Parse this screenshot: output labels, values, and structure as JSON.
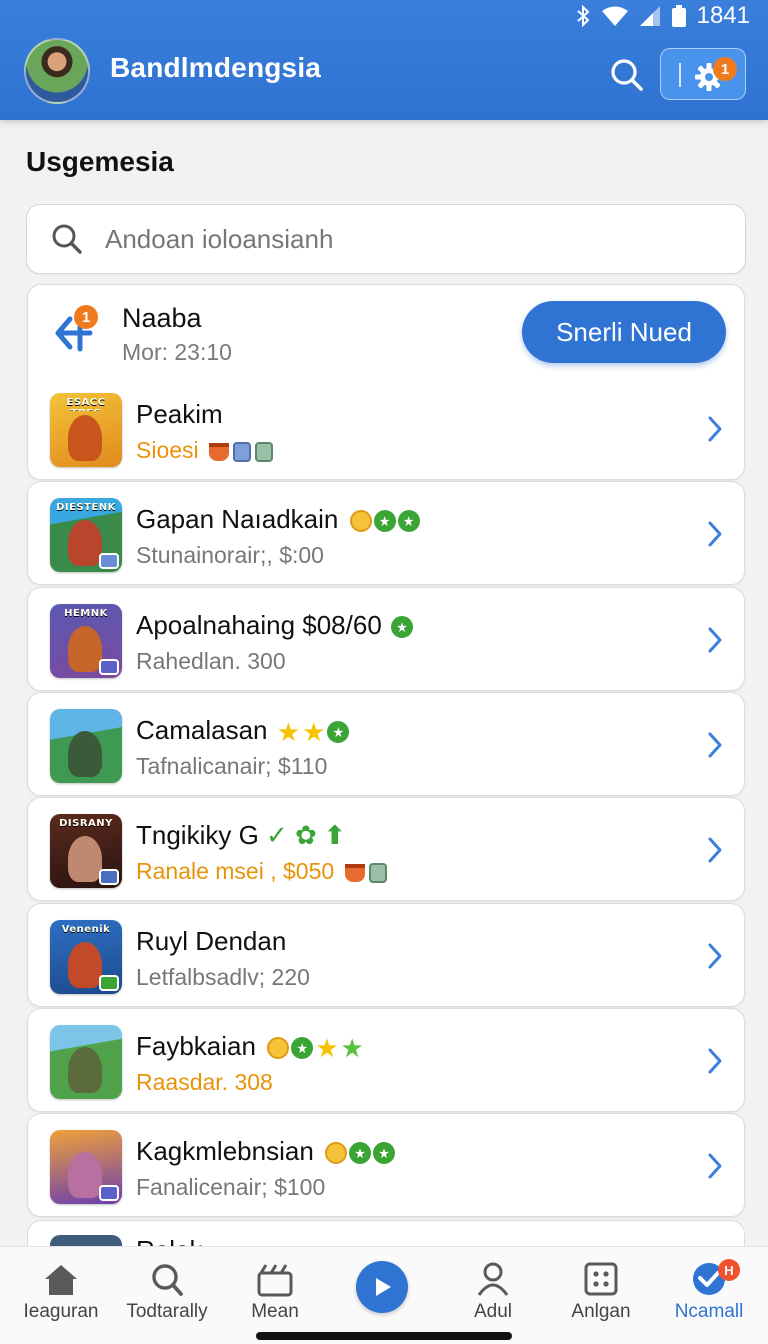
{
  "status_bar": {
    "time": "1841"
  },
  "header": {
    "app_title": "Bandlmdengsia",
    "settings_badge": "1"
  },
  "section_title": "Usgemesia",
  "search": {
    "placeholder": "Andoan ioloansianh"
  },
  "top_card": {
    "name": "Naaba",
    "time": "Mor: 23:10",
    "badge": "1",
    "button_label": "Snerli Nued"
  },
  "games": [
    {
      "name": "Peakim",
      "sub": "Sioesi",
      "sub_style": "orange",
      "tag": "ESACC TRES",
      "palette": [
        "#f0b22a",
        "#c8551b"
      ]
    },
    {
      "name": "Gapan Naıadkain",
      "sub": "Stunainorair;, $:00",
      "sub_style": "gray",
      "tag": "DIESTENK",
      "palette": [
        "#31a0d8",
        "#b8452c"
      ]
    },
    {
      "name": "Apoalnahaing $08/60",
      "sub": "Rahedlan. 300",
      "sub_style": "gray",
      "tag": "HEMNK",
      "palette": [
        "#6a5fb4",
        "#c5652a"
      ]
    },
    {
      "name": "Camalasan",
      "sub": "Tafnalicanair; $110",
      "sub_style": "gray",
      "tag": "",
      "palette": [
        "#3e9a52",
        "#3b5a3a"
      ]
    },
    {
      "name": "Tngikiky G",
      "sub": "Ranale msei , $050",
      "sub_style": "orange",
      "tag": "DISRANY",
      "palette": [
        "#5b2a1e",
        "#c08870"
      ]
    },
    {
      "name": "Ruyl Dendan",
      "sub": "Letfalbsadlv; 220",
      "sub_style": "gray",
      "tag": "Venenik",
      "palette": [
        "#2e6fc4",
        "#c24a2a"
      ]
    },
    {
      "name": "Faybkaian",
      "sub": "Raasdar. 308",
      "sub_style": "orange",
      "tag": "",
      "palette": [
        "#4fa24a",
        "#5b6b3b"
      ]
    },
    {
      "name": "Kagkmlebnsian",
      "sub": "Fanalicenair; $100",
      "sub_style": "gray",
      "tag": "",
      "palette": [
        "#e2622a",
        "#6b3fb0"
      ]
    }
  ],
  "peek_item": {
    "name": "Relak"
  },
  "bottom_nav": {
    "items": [
      {
        "label": "Ieaguran"
      },
      {
        "label": "Todtarally"
      },
      {
        "label": "Mean"
      },
      {
        "label": ""
      },
      {
        "label": "Adul"
      },
      {
        "label": "Anlgan"
      },
      {
        "label": "Ncamall",
        "badge": "H"
      }
    ]
  },
  "colors": {
    "accent": "#2f74d3",
    "header": "#3a7fdb",
    "badge": "#f07a1e",
    "orange_text": "#e8930a"
  }
}
